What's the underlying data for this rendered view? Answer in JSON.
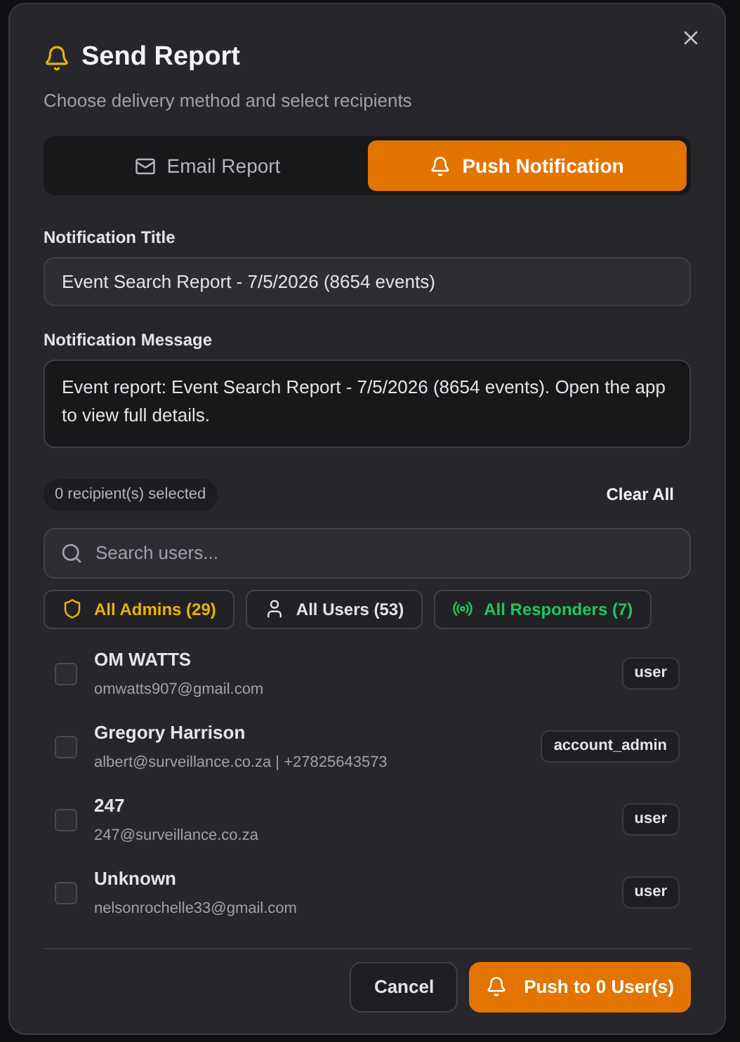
{
  "dialog": {
    "title": "Send Report",
    "subtitle": "Choose delivery method and select recipients"
  },
  "tabs": [
    {
      "label": "Email Report",
      "kind": "mail",
      "selected": false
    },
    {
      "label": "Push Notification",
      "kind": "bell",
      "selected": true
    }
  ],
  "fields": [
    {
      "label": "Notification Title",
      "kind": "input",
      "value": "Event Search Report - 7/5/2026 (8654 events)"
    },
    {
      "label": "Notification Message",
      "kind": "textarea",
      "value": "Event report: Event Search Report - 7/5/2026 (8654 events). Open the app to view full details."
    }
  ],
  "recipients_count": "0 recipient(s) selected",
  "clear_all": "Clear All",
  "search": {
    "placeholder": "Search users..."
  },
  "groups": [
    {
      "label": "All Admins (29)",
      "kind": "shield",
      "color": "#eab308"
    },
    {
      "label": "All Users (53)",
      "kind": "user",
      "color": "#e4e4e7"
    },
    {
      "label": "All Responders (7)",
      "kind": "radio",
      "color": "#22c55e"
    }
  ],
  "users": [
    {
      "name": "OM WATTS",
      "detail": "omwatts907@gmail.com",
      "role": "user",
      "checked": false
    },
    {
      "name": "Gregory Harrison",
      "detail": "albert@surveillance.co.za | +27825643573",
      "role": "account_admin",
      "checked": false
    },
    {
      "name": "247",
      "detail": "247@surveillance.co.za",
      "role": "user",
      "checked": false
    },
    {
      "name": "Unknown",
      "detail": "nelsonrochelle33@gmail.com",
      "role": "user",
      "checked": false
    }
  ],
  "buttons": {
    "cancel": "Cancel",
    "submit": "Push to 0 User(s)"
  }
}
